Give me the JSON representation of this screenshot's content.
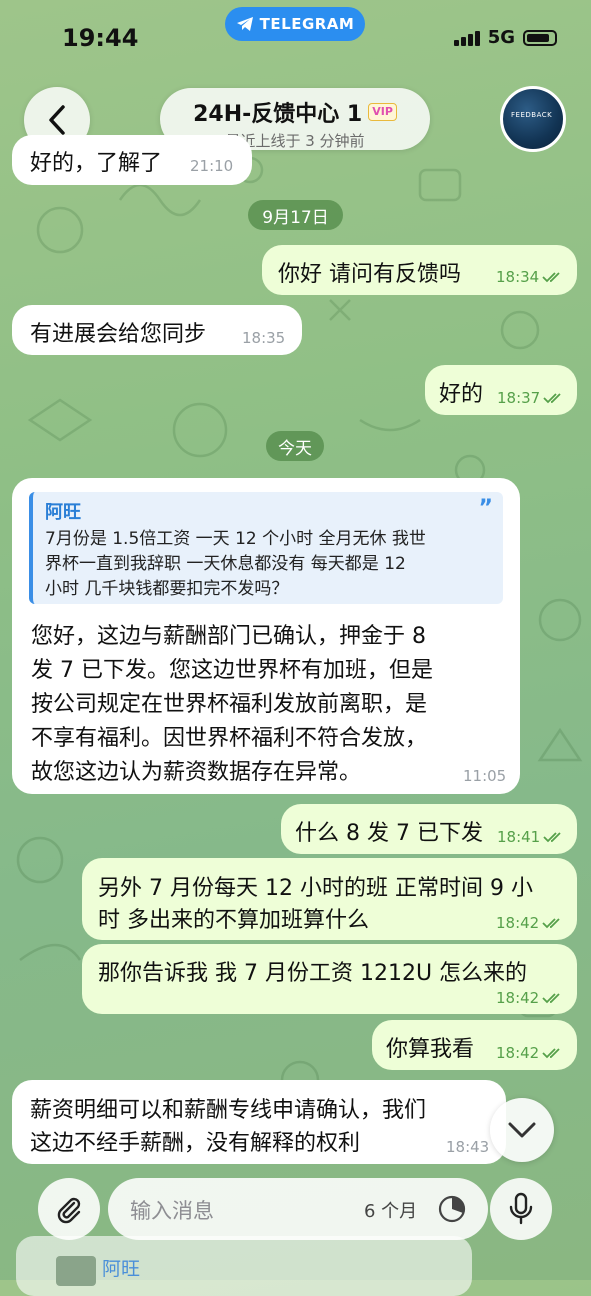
{
  "status_bar": {
    "time": "19:44",
    "app_pill": "TELEGRAM",
    "network": "5G"
  },
  "header": {
    "title": "24H-反馈中心 1",
    "vip_badge": "VIP",
    "subtitle": "最近上线于 3 分钟前",
    "avatar_label": "FEEDBACK"
  },
  "messages": [
    {
      "dir": "in",
      "text": "好的，了解了",
      "time": "21:10"
    },
    {
      "type": "date",
      "text": "9月17日"
    },
    {
      "dir": "out",
      "text": "你好 请问有反馈吗",
      "time": "18:34",
      "read": true
    },
    {
      "dir": "in",
      "text": "有进展会给您同步",
      "time": "18:35"
    },
    {
      "dir": "out",
      "text": "好的",
      "time": "18:37",
      "read": true
    },
    {
      "type": "date",
      "text": "今天"
    },
    {
      "dir": "in",
      "reply": {
        "name": "阿旺",
        "lines": [
          "7月份是 1.5倍工资 一天 12 个小时 全月无休 我世",
          "界杯一直到我辞职 一天休息都没有 每天都是 12",
          "小时 几千块钱都要扣完不发吗？"
        ]
      },
      "lines": [
        "您好，这边与薪酬部门已确认，押金于 8",
        "发 7 已下发。您这边世界杯有加班，但是",
        "按公司规定在世界杯福利发放前离职，是",
        "不享有福利。因世界杯福利不符合发放，",
        "故您这边认为薪资数据存在异常。"
      ],
      "time": "11:05"
    },
    {
      "dir": "out",
      "text": "什么 8 发 7 已下发",
      "time": "18:41",
      "read": true
    },
    {
      "dir": "out",
      "lines": [
        "另外 7 月份每天 12 小时的班 正常时间 9 小",
        "时 多出来的不算加班算什么"
      ],
      "time": "18:42",
      "read": true
    },
    {
      "dir": "out",
      "text": "那你告诉我 我 7 月份工资 1212U 怎么来的",
      "time": "18:42",
      "read": true
    },
    {
      "dir": "out",
      "text": "你算我看",
      "time": "18:42",
      "read": true
    },
    {
      "dir": "in",
      "lines": [
        "薪资明细可以和薪酬专线申请确认，我们",
        "这边不经手薪酬，没有解释的权利"
      ],
      "time": "18:43"
    }
  ],
  "input": {
    "placeholder": "输入消息",
    "timer_label": "6 个月"
  },
  "partial_reply_name": "阿旺",
  "colors": {
    "incoming_bubble": "#ffffff",
    "outgoing_bubble": "#eefed7",
    "accent_blue": "#2b8ef0",
    "read_check": "#56a04a"
  },
  "icons": [
    "telegram-icon",
    "back-chevron-icon",
    "quote-icon",
    "read-check-icon",
    "chevron-down-icon",
    "paperclip-icon",
    "timer-icon",
    "microphone-icon"
  ]
}
